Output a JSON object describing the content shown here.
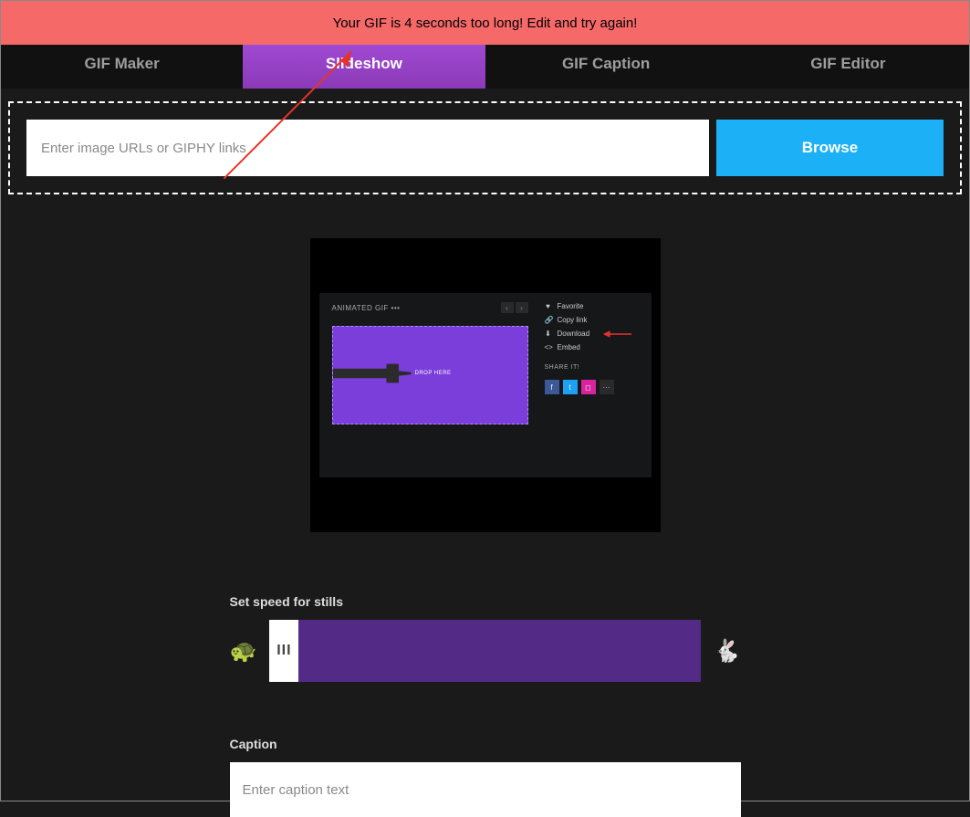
{
  "error_banner": "Your GIF is 4 seconds too long! Edit and try again!",
  "tabs": {
    "gif_maker": "GIF Maker",
    "slideshow": "Slideshow",
    "gif_caption": "GIF Caption",
    "gif_editor": "GIF Editor"
  },
  "upload": {
    "placeholder": "Enter image URLs or GIPHY links",
    "browse": "Browse"
  },
  "preview": {
    "label": "ANIMATED GIF   •••",
    "drop_text": "DROP        HERE",
    "actions": {
      "favorite": "Favorite",
      "copy_link": "Copy link",
      "download": "Download",
      "embed": "Embed"
    },
    "share_title": "SHARE IT!"
  },
  "speed": {
    "label": "Set speed for stills",
    "handle": "III"
  },
  "caption": {
    "label": "Caption",
    "placeholder": "Enter caption text"
  }
}
